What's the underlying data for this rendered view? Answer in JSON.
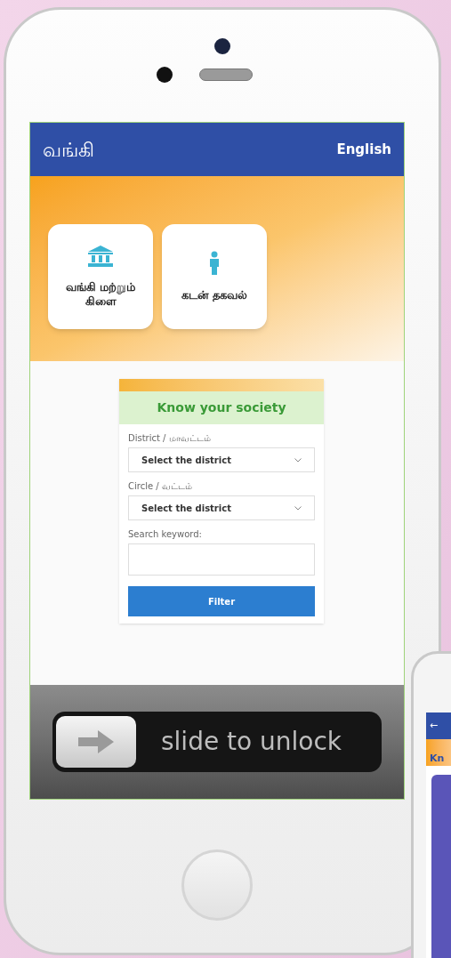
{
  "app_bar": {
    "title": "வங்கி",
    "language_link": "English"
  },
  "tiles": [
    {
      "label": "வங்கி மற்றும் கிளை",
      "kind": "bank"
    },
    {
      "label": "கடன் தகவல்",
      "kind": "person"
    }
  ],
  "society_form": {
    "title": "Know your society",
    "fields": [
      {
        "kind": "select",
        "label": "District / மாவட்டம்",
        "value": "Select the district"
      },
      {
        "kind": "select",
        "label": "Circle / வட்டம்",
        "value": "Select the district"
      },
      {
        "kind": "text",
        "label": "Search keyword:"
      }
    ],
    "button": "Filter"
  },
  "lock_slider": {
    "text": "slide to unlock"
  },
  "second_phone": {
    "back": "←",
    "text": "Kn"
  }
}
